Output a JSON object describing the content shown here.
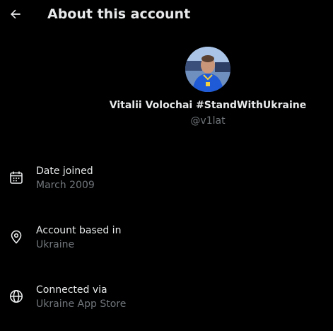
{
  "header": {
    "back_icon": "arrow-left-icon",
    "title": "About this account"
  },
  "profile": {
    "avatar_icon": "profile-photo",
    "display_name": "Vitalii Volochai #StandWithUkraine",
    "handle": "@v1lat"
  },
  "info": [
    {
      "icon": "calendar-icon",
      "label": "Date joined",
      "value": "March 2009"
    },
    {
      "icon": "location-pin-icon",
      "label": "Account based in",
      "value": "Ukraine"
    },
    {
      "icon": "globe-icon",
      "label": "Connected via",
      "value": "Ukraine App Store"
    }
  ],
  "colors": {
    "background": "#000000",
    "primary_text": "#e7e9ea",
    "secondary_text": "#71767b"
  }
}
